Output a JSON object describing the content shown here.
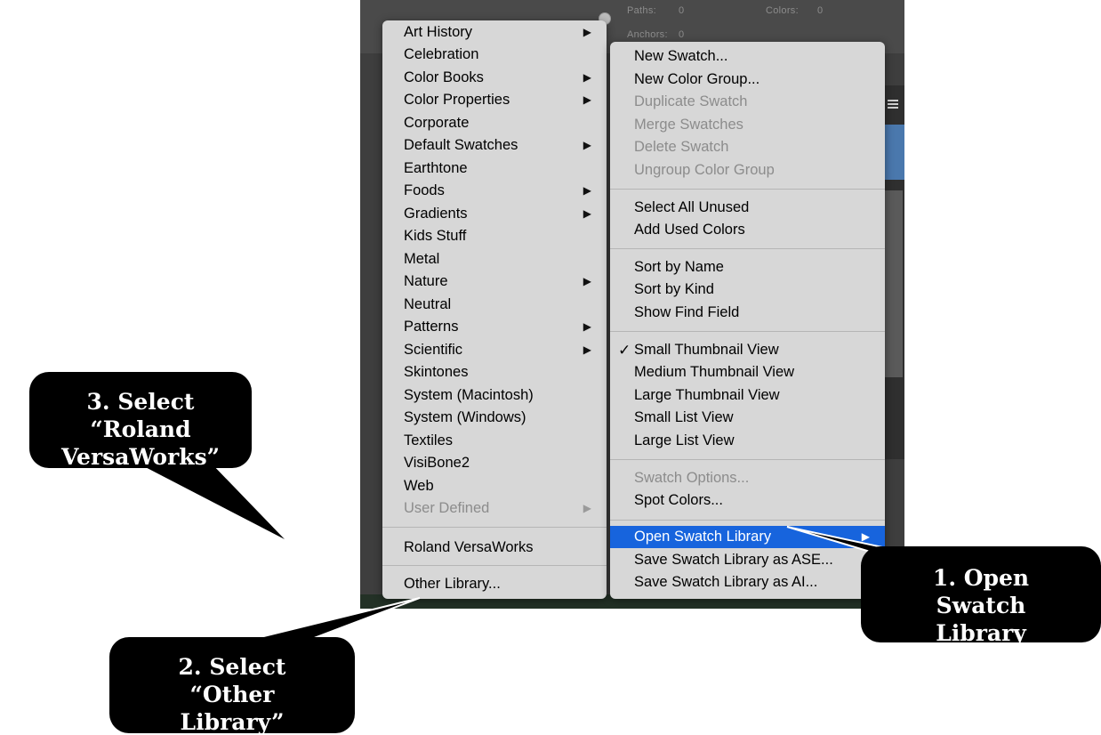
{
  "app_info": {
    "paths_label": "Paths:",
    "paths_value": "0",
    "colors_label": "Colors:",
    "colors_value": "0",
    "anchors_label": "Anchors:",
    "anchors_value": "0"
  },
  "library_menu": {
    "items": [
      {
        "label": "Art History",
        "submenu": true
      },
      {
        "label": "Celebration"
      },
      {
        "label": "Color Books",
        "submenu": true
      },
      {
        "label": "Color Properties",
        "submenu": true
      },
      {
        "label": "Corporate"
      },
      {
        "label": "Default Swatches",
        "submenu": true
      },
      {
        "label": "Earthtone"
      },
      {
        "label": "Foods",
        "submenu": true
      },
      {
        "label": "Gradients",
        "submenu": true
      },
      {
        "label": "Kids Stuff"
      },
      {
        "label": "Metal"
      },
      {
        "label": "Nature",
        "submenu": true
      },
      {
        "label": "Neutral"
      },
      {
        "label": "Patterns",
        "submenu": true
      },
      {
        "label": "Scientific",
        "submenu": true
      },
      {
        "label": "Skintones"
      },
      {
        "label": "System (Macintosh)"
      },
      {
        "label": "System (Windows)"
      },
      {
        "label": "Textiles"
      },
      {
        "label": "VisiBone2"
      },
      {
        "label": "Web"
      },
      {
        "label": "User Defined",
        "submenu": true,
        "disabled": true
      },
      {
        "label": "Roland VersaWorks"
      },
      {
        "label": "Other Library..."
      }
    ]
  },
  "swatches_menu": {
    "items": [
      {
        "label": "New Swatch..."
      },
      {
        "label": "New Color Group..."
      },
      {
        "label": "Duplicate Swatch",
        "disabled": true
      },
      {
        "label": "Merge Swatches",
        "disabled": true
      },
      {
        "label": "Delete Swatch",
        "disabled": true
      },
      {
        "label": "Ungroup Color Group",
        "disabled": true
      },
      {
        "label": "Select All Unused"
      },
      {
        "label": "Add Used Colors"
      },
      {
        "label": "Sort by Name"
      },
      {
        "label": "Sort by Kind"
      },
      {
        "label": "Show Find Field"
      },
      {
        "label": "Small Thumbnail View",
        "checked": true
      },
      {
        "label": "Medium Thumbnail View"
      },
      {
        "label": "Large Thumbnail View"
      },
      {
        "label": "Small List View"
      },
      {
        "label": "Large List View"
      },
      {
        "label": "Swatch Options...",
        "disabled": true
      },
      {
        "label": "Spot Colors..."
      },
      {
        "label": "Open Swatch Library",
        "submenu": true,
        "highlighted": true
      },
      {
        "label": "Save Swatch Library as ASE..."
      },
      {
        "label": "Save Swatch Library as AI..."
      }
    ],
    "check_mark": "✓",
    "submenu_arrow": "▶"
  },
  "callouts": {
    "step1": [
      "1. Open",
      "Swatch",
      "Library"
    ],
    "step2": [
      "2. Select",
      "“Other",
      "Library”"
    ],
    "step3": [
      "3. Select",
      "“Roland",
      "VersaWorks”"
    ]
  },
  "colors": {
    "menu_bg": "#d7d7d7",
    "highlight": "#1764dd",
    "callout_bg": "#000000",
    "app_bg": "#3e3e3e"
  }
}
